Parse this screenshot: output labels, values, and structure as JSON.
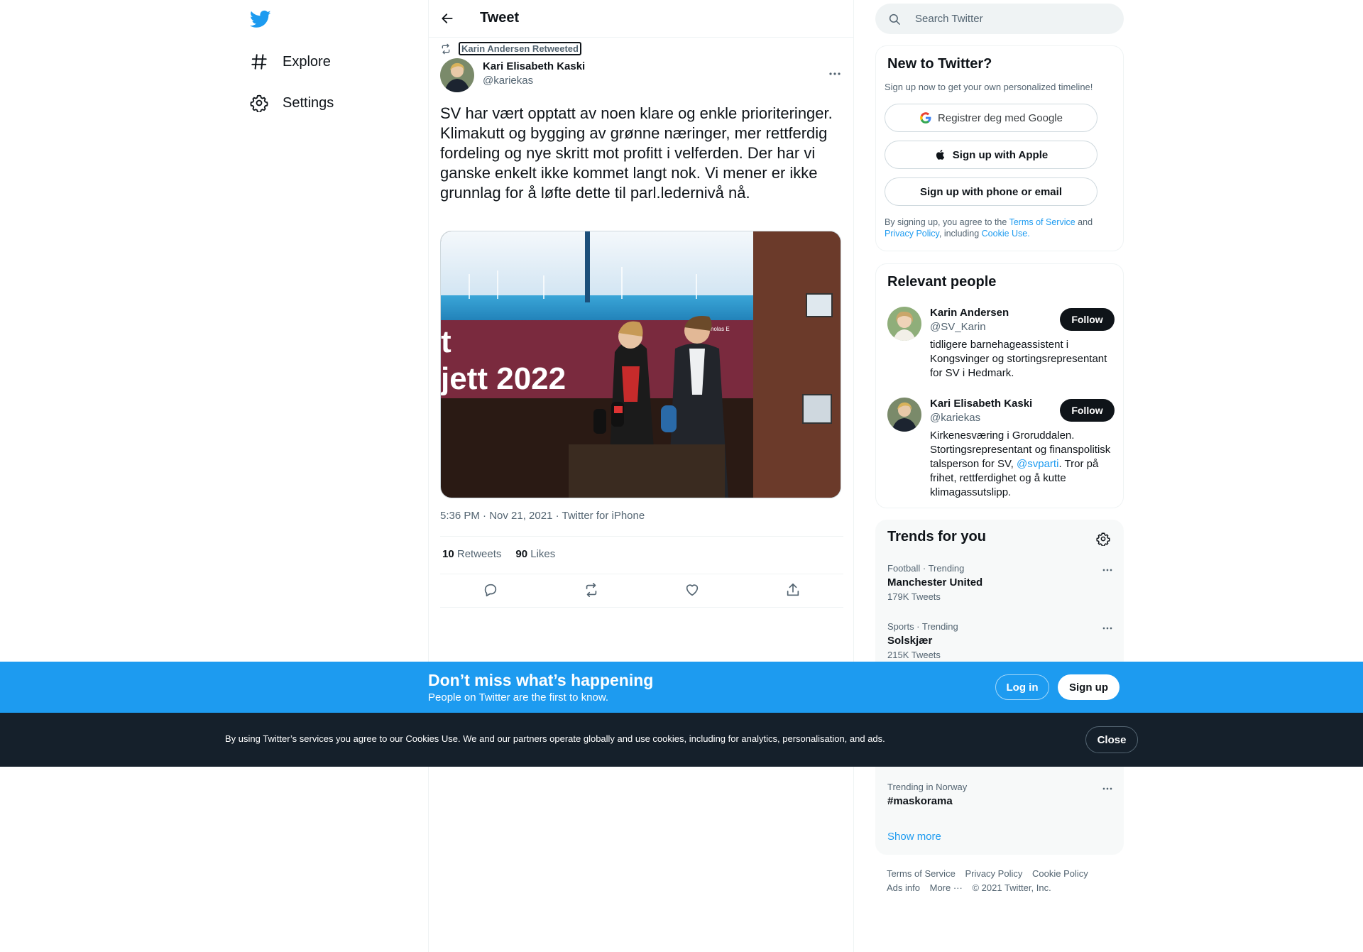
{
  "nav": {
    "items": [
      {
        "label": "Explore",
        "icon": "hashtag-icon"
      },
      {
        "label": "Settings",
        "icon": "gear-icon"
      }
    ]
  },
  "header": {
    "title": "Tweet"
  },
  "tweet": {
    "retweeted_by": "Karin Andersen Retweeted",
    "author_name": "Kari Elisabeth Kaski",
    "author_handle": "@kariekas",
    "text": "SV har vært opptatt av noen klare og enkle prioriteringer. Klimakutt og bygging av grønne næringer, mer rettferdig fordeling og nye skritt mot profitt i velferden. Der har vi ganske enkelt ikke kommet langt nok. Vi mener er ikke grunnlag for å løfte dette til parl.ledernivå nå.",
    "image_caption_text": "jett 2022",
    "image_credit": "Foto: Nicholas E",
    "meta": "5:36 PM · Nov 21, 2021 · Twitter for iPhone",
    "retweets_count": "10",
    "retweets_label": "Retweets",
    "likes_count": "90",
    "likes_label": "Likes"
  },
  "search": {
    "placeholder": "Search Twitter"
  },
  "new_to_twitter": {
    "title": "New to Twitter?",
    "subtitle": "Sign up now to get your own personalized timeline!",
    "google_label": "Registrer deg med Google",
    "apple_label": "Sign up with Apple",
    "phone_label": "Sign up with phone or email",
    "legal_1": "By signing up, you agree to the ",
    "tos": "Terms of Service",
    "legal_2": " and ",
    "privacy": "Privacy Policy",
    "legal_3": ", including ",
    "cookie": "Cookie Use."
  },
  "relevant": {
    "title": "Relevant people",
    "follow_label": "Follow",
    "people": [
      {
        "name": "Karin Andersen",
        "handle": "@SV_Karin",
        "bio": "tidligere barnehageassistent i Kongsvinger og stortingsrepresentant for SV i Hedmark."
      },
      {
        "name": "Kari Elisabeth Kaski",
        "handle": "@kariekas",
        "bio_1": "Kirkenesværing i Groruddalen. Stortingsrepresentant og finanspolitisk talsperson for SV, ",
        "bio_link": "@svparti",
        "bio_2": ". Tror på frihet, rettferdighet og å kutte klimagassutslipp."
      }
    ]
  },
  "trends": {
    "title": "Trends for you",
    "items": [
      {
        "category": "Football · Trending",
        "name": "Manchester United",
        "count": "179K Tweets"
      },
      {
        "category": "Sports · Trending",
        "name": "Solskjær",
        "count": "215K Tweets"
      },
      {
        "category": "Trending in Norway",
        "name": "#maskorama",
        "count": ""
      }
    ],
    "show_more": "Show more"
  },
  "footer": {
    "links": [
      "Terms of Service",
      "Privacy Policy",
      "Cookie Policy",
      "Ads info",
      "More ···",
      "© 2021 Twitter, Inc."
    ]
  },
  "banner": {
    "title": "Don’t miss what’s happening",
    "subtitle": "People on Twitter are the first to know.",
    "login": "Log in",
    "signup": "Sign up"
  },
  "cookie_bar": {
    "text": "By using Twitter’s services you agree to our Cookies Use. We and our partners operate globally and use cookies, including for analytics, personalisation, and ads.",
    "close": "Close"
  },
  "colors": {
    "accent": "#1d9bf0",
    "dark": "#0f1419",
    "muted": "#536471",
    "cookie_bg": "#15202b"
  }
}
